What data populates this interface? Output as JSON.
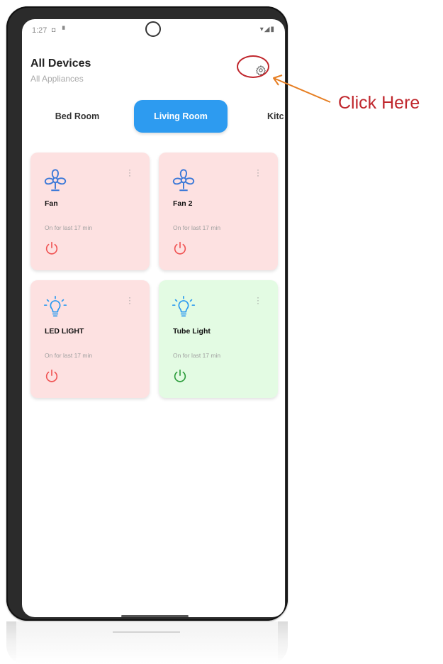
{
  "status_bar": {
    "time": "1:27",
    "right_icons": "▾◢▮"
  },
  "header": {
    "title": "All Devices",
    "subtitle": "All Appliances"
  },
  "tabs": [
    {
      "label": "Bed Room",
      "active": false
    },
    {
      "label": "Living Room",
      "active": true
    },
    {
      "label": "Kitc",
      "active": false
    }
  ],
  "devices": [
    {
      "name": "Fan",
      "status": "On for last 17 min",
      "icon": "fan-icon",
      "state": "off"
    },
    {
      "name": "Fan 2",
      "status": "On for last 17 min",
      "icon": "fan-icon",
      "state": "off"
    },
    {
      "name": "LED LIGHT",
      "status": "On for last 17 min",
      "icon": "bulb-icon",
      "state": "off"
    },
    {
      "name": "Tube Light",
      "status": "On for last 17 min",
      "icon": "bulb-icon",
      "state": "on"
    }
  ],
  "annotation": {
    "text": "Click Here",
    "color": "#c0272d",
    "arrow_color": "#e67e22"
  },
  "colors": {
    "accent": "#2d9bf0",
    "card_off": "#fde1e1",
    "card_on": "#e3fbe3",
    "power_off": "#f05454",
    "power_on": "#2e9e3e",
    "icon_blue": "#3a78d8"
  }
}
